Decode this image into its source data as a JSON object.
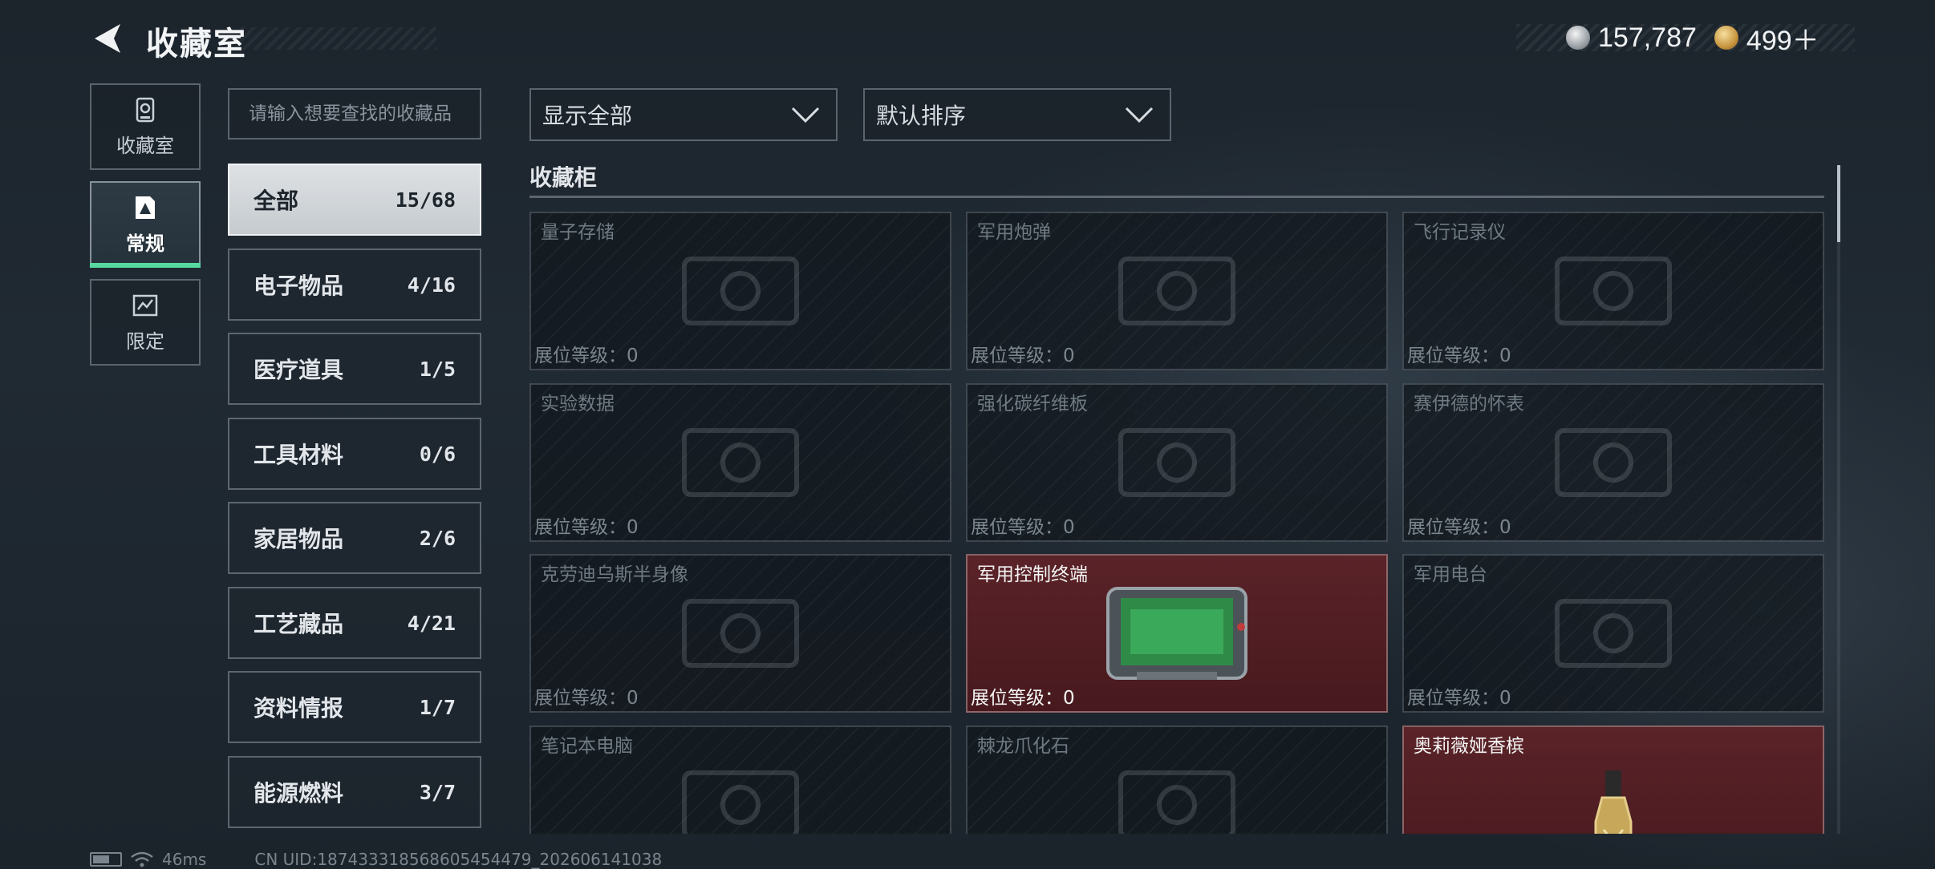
{
  "header": {
    "title": "收藏室",
    "currency": [
      {
        "icon": "silver-coin-icon",
        "value": "157,787"
      },
      {
        "icon": "gold-coin-icon",
        "value": "499＋"
      }
    ]
  },
  "rail": [
    {
      "label": "收藏室",
      "icon": "collection-room-icon",
      "active": false
    },
    {
      "label": "常规",
      "icon": "regular-collection-icon",
      "active": true
    },
    {
      "label": "限定",
      "icon": "limited-collection-icon",
      "active": false
    }
  ],
  "search": {
    "placeholder": "请输入想要查找的收藏品",
    "value": ""
  },
  "categories": [
    {
      "name": "全部",
      "count": "15/68",
      "active": true
    },
    {
      "name": "电子物品",
      "count": "4/16"
    },
    {
      "name": "医疗道具",
      "count": "1/5"
    },
    {
      "name": "工具材料",
      "count": "0/6"
    },
    {
      "name": "家居物品",
      "count": "2/6"
    },
    {
      "name": "工艺藏品",
      "count": "4/21"
    },
    {
      "name": "资料情报",
      "count": "1/7"
    },
    {
      "name": "能源燃料",
      "count": "3/7"
    }
  ],
  "filters": {
    "display": {
      "selected": "显示全部"
    },
    "sort": {
      "selected": "默认排序"
    }
  },
  "section": {
    "title": "收藏柜"
  },
  "items": [
    {
      "name": "量子存储",
      "level": "展位等级：0",
      "owned": false
    },
    {
      "name": "军用炮弹",
      "level": "展位等级：0",
      "owned": false
    },
    {
      "name": "飞行记录仪",
      "level": "展位等级：0",
      "owned": false
    },
    {
      "name": "实验数据",
      "level": "展位等级：0",
      "owned": false
    },
    {
      "name": "强化碳纤维板",
      "level": "展位等级：0",
      "owned": false
    },
    {
      "name": "赛伊德的怀表",
      "level": "展位等级：0",
      "owned": false
    },
    {
      "name": "克劳迪乌斯半身像",
      "level": "展位等级：0",
      "owned": false
    },
    {
      "name": "军用控制终端",
      "level": "展位等级：0",
      "owned": true
    },
    {
      "name": "军用电台",
      "level": "展位等级：0",
      "owned": false
    },
    {
      "name": "笔记本电脑",
      "level": "",
      "owned": false
    },
    {
      "name": "棘龙爪化石",
      "level": "",
      "owned": false
    },
    {
      "name": "奥莉薇娅香槟",
      "level": "",
      "owned": true
    }
  ],
  "footer": {
    "ping": "46ms",
    "uid": "CN UID:18743331856860545447​9_202606141038"
  },
  "colors": {
    "accent": "#57d8a1",
    "owned_card": "#5a2328",
    "selected_category": "#dde1e4"
  }
}
